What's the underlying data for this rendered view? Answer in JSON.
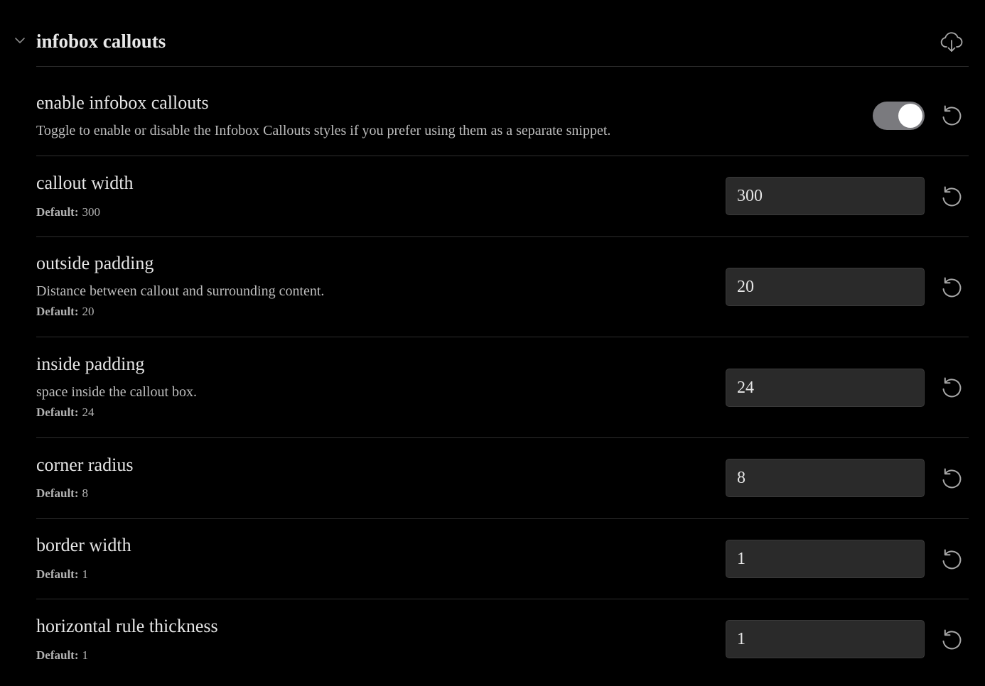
{
  "section": {
    "title": "infobox callouts"
  },
  "icons": {
    "collapse": "chevron-down-icon",
    "download": "cloud-download-icon",
    "reset": "reset-rotate-ccw-icon"
  },
  "colors": {
    "background": "#000000",
    "toggle_on": "#7a7a7e",
    "input_bg": "#2a2a2a"
  },
  "settings": {
    "enable": {
      "name": "enable infobox callouts",
      "description": "Toggle to enable or disable the Infobox Callouts styles if you prefer using them as a separate snippet.",
      "enabled": true
    },
    "callout_width": {
      "name": "callout width",
      "default_label": "Default:",
      "default_value": "300",
      "value": "300"
    },
    "outside_padding": {
      "name": "outside padding",
      "description": "Distance between callout and surrounding content.",
      "default_label": "Default:",
      "default_value": "20",
      "value": "20"
    },
    "inside_padding": {
      "name": "inside padding",
      "description": "space inside the callout box.",
      "default_label": "Default:",
      "default_value": "24",
      "value": "24"
    },
    "corner_radius": {
      "name": "corner radius",
      "default_label": "Default:",
      "default_value": "8",
      "value": "8"
    },
    "border_width": {
      "name": "border width",
      "default_label": "Default:",
      "default_value": "1",
      "value": "1"
    },
    "hr_thickness": {
      "name": "horizontal rule thickness",
      "default_label": "Default:",
      "default_value": "1",
      "value": "1"
    }
  }
}
